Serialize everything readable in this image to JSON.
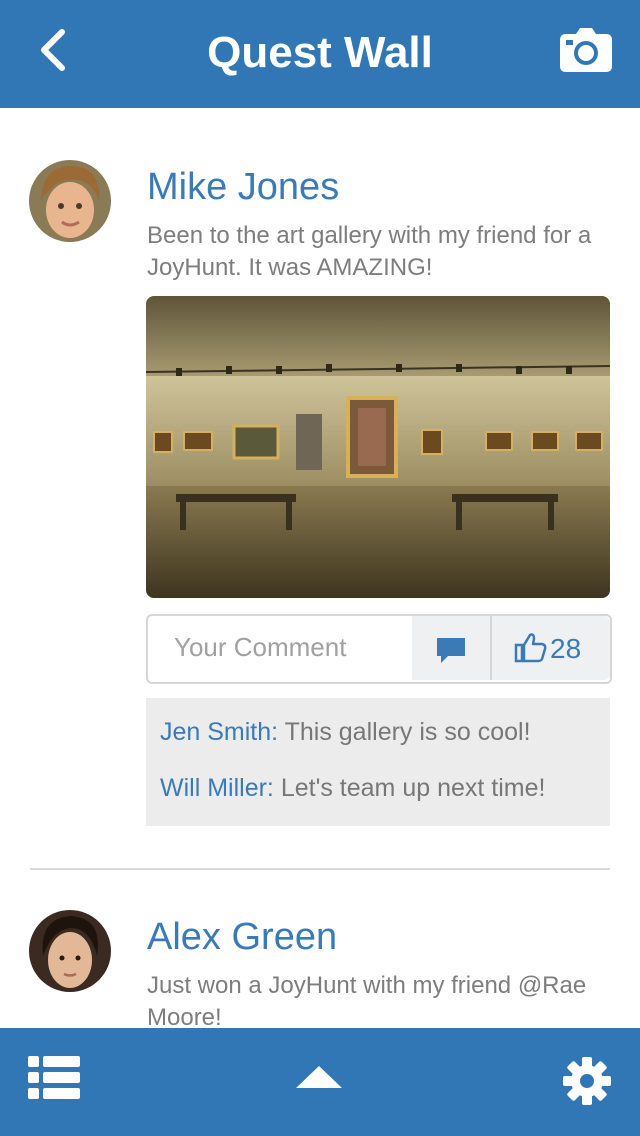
{
  "header": {
    "title": "Quest Wall",
    "back_icon": "chevron-left-icon",
    "camera_icon": "camera-icon"
  },
  "posts": [
    {
      "author": "Mike Jones",
      "text": "Been to the art gallery with my friend for a JoyHunt. It was AMAZING!",
      "comment_placeholder": "Your Comment",
      "likes": "28",
      "comments": [
        {
          "author": "Jen Smith:",
          "text": " This gallery is so cool!"
        },
        {
          "author": "Will Miller:",
          "text": " Let's team up next time!"
        }
      ]
    },
    {
      "author": "Alex Green",
      "text": "Just won a JoyHunt with my friend @Rae Moore!"
    }
  ],
  "footer": {
    "list_icon": "list-icon",
    "up_icon": "chevron-up-icon",
    "settings_icon": "gear-icon"
  },
  "colors": {
    "brand": "#3177b5",
    "link": "#3a7ab6",
    "text": "#7d7d7d"
  }
}
